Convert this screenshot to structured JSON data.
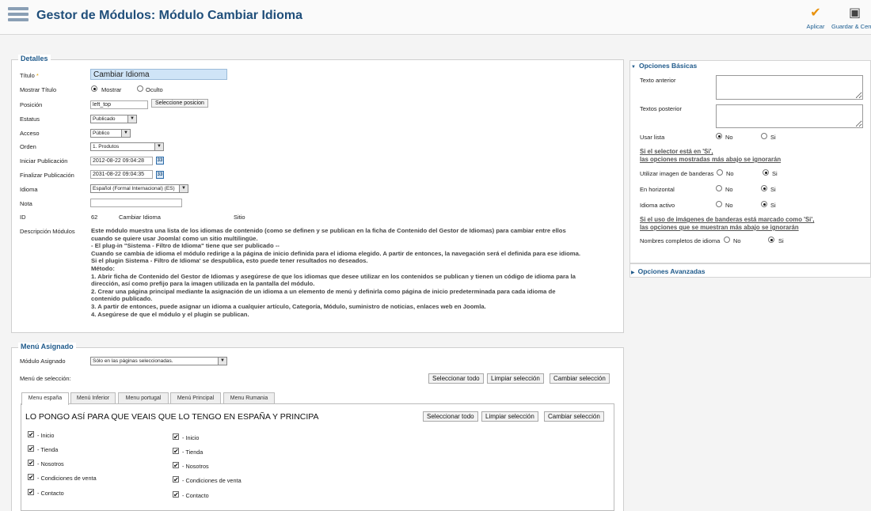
{
  "header": {
    "title": "Gestor de Módulos: Módulo Cambiar Idioma",
    "apply_label": "Aplicar",
    "save_close_label": "Guardar & Cerrar"
  },
  "details": {
    "legend": "Detalles",
    "title_label": "Título",
    "required_mark": "*",
    "title_value": "Cambiar Idioma",
    "show_title_label": "Mostrar Título",
    "show_option": "Mostrar",
    "hide_option": "Oculto",
    "position_label": "Posición",
    "position_value": "left_top",
    "select_position_button": "Seleccione posicion",
    "status_label": "Estatus",
    "status_value": "Publicado",
    "access_label": "Acceso",
    "access_value": "Público",
    "order_label": "Orden",
    "order_value": "1. Produtos",
    "start_label": "Iniciar Publicación",
    "start_value": "2012-08-22 09:04:28",
    "end_label": "Finalizar Publicación",
    "end_value": "2031-08-22 09:04:35",
    "calendar_icon_text": "33",
    "language_label": "Idioma",
    "language_value": "Español (Formal Internacional) (ES)",
    "note_label": "Nota",
    "note_value": "",
    "id_label": "ID",
    "id_value": "62",
    "module_name": "Cambiar Idioma",
    "site_label": "Sitio",
    "description_label": "Descripción Módulos",
    "description": "Este módulo muestra una lista de los idiomas de contenido (como se definen y se publican en la ficha de Contenido del Gestor de Idiomas) para cambiar entre ellos\n cuando se quiere usar Joomla! como un sitio multilingüe.\n- El plug-in \"Sistema - Filtro de Idioma\" tiene que ser publicado --\nCuando se cambia de idioma el módulo redirige a la página de inicio definida para el idioma elegido. A partir de entonces, la navegación será el definida para ese idioma.\nSi el plugin Sistema - Filtro de Idioma' se despublica, esto puede tener resultados no deseados.\nMétodo:\n1. Abrir ficha de Contenido del Gestor de Idiomas y asegúrese de que los idiomas que desee utilizar en los contenidos se publican y tienen un código de idioma para la\ndirección, así como prefijo para la imagen utilizada en la pantalla del módulo.\n2. Crear una página principal mediante la asignación de un idioma a un elemento de menú y definirla como página de inicio predeterminada para cada idioma de\ncontenido publicado.\n3. A partir de entonces, puede asignar un idioma a cualquier artículo, Categoría, Módulo, suministro de noticias, enlaces web en Joomla.\n4. Asegúrese de que el módulo y el plugin se publican."
  },
  "basic_options": {
    "title": "Opciones Básicas",
    "text_before_label": "Texto anterior",
    "text_before_value": "",
    "text_after_label": "Textos posterior",
    "text_after_value": "",
    "use_list_label": "Usar lista",
    "no_label": "No",
    "yes_label": "Si",
    "note1_line1": "Si el selector está en 'Si',",
    "note1_line2": "las opciones mostradas más abajo se ignorarán",
    "flags_label": "Utilizar imagen de banderas",
    "horizontal_label": "En horizontal",
    "active_lang_label": "Idioma activo",
    "note2_line1": "Si el uso de imágenes de banderas está marcado como 'Si',",
    "note2_line2": "las opciones que se muestran más abajo se ignorarán",
    "full_names_label": "Nombres completos de idioma"
  },
  "advanced_options": {
    "title": "Opciones Avanzadas"
  },
  "menu_assignment": {
    "legend": "Menú Asignado",
    "module_assignment_label": "Módulo Asignado",
    "module_assignment_value": "Sólo en las páginas seleccionadas.",
    "menu_selection_label": "Menú de selección:",
    "select_all": "Seleccionar todo",
    "clear_selection": "Limpiar selección",
    "toggle_selection": "Cambiar selección",
    "tabs": [
      "Menu españa",
      "Menú Inferior",
      "Menu portugal",
      "Menú Principal",
      "Menu Rumania"
    ],
    "panel_title": "LO PONGO ASÍ PARA QUE VEAIS QUE LO TENGO EN ESPAÑA Y PRINCIPA",
    "check_mark": "✔",
    "col1_items": [
      "- Inicio",
      "- Tienda",
      "- Nosotros",
      "- Condiciones de venta",
      "- Contacto"
    ],
    "col2_items": [
      "- Inicio",
      "- Tienda",
      "- Nosotros",
      "- Condiciones de venta",
      "- Contacto"
    ]
  }
}
